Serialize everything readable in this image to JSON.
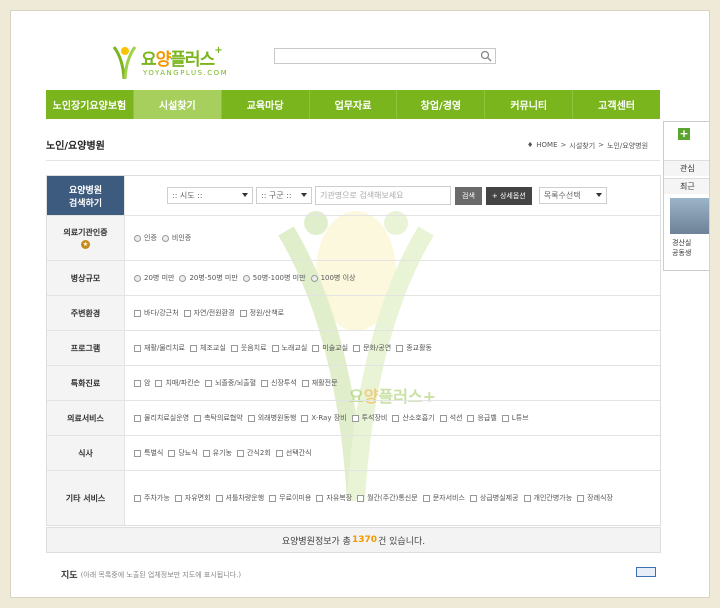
{
  "header": {
    "logo_text_a": "요",
    "logo_text_b": "양",
    "logo_text_c": "플러스",
    "logo_plus": "+",
    "logo_sub": "YOYANGPLUS.COM",
    "search_placeholder": "",
    "accent_color": "#7ab51d",
    "logo_orange": "#f39800"
  },
  "nav": {
    "items": [
      {
        "label": "노인장기요양보험",
        "active": false
      },
      {
        "label": "시설찾기",
        "active": true
      },
      {
        "label": "교육마당",
        "active": false
      },
      {
        "label": "업무자료",
        "active": false
      },
      {
        "label": "창업/경영",
        "active": false
      },
      {
        "label": "커뮤니티",
        "active": false
      },
      {
        "label": "고객센터",
        "active": false
      }
    ]
  },
  "side": {
    "tab1": "관심",
    "tab2": "최근",
    "caption1": "경산실",
    "caption2": "공동생"
  },
  "page": {
    "title": "노인/요양병원",
    "breadcrumb": [
      "HOME",
      ">",
      "시설찾기",
      ">",
      "노인/요양병원"
    ]
  },
  "form": {
    "header_label_1": "요양병원",
    "header_label_2": "검색하기",
    "sido": ":: 시도 ::",
    "gugun": ":: 구군 ::",
    "keyword_placeholder": "기관명으로 검색해보세요",
    "search_button": "검색",
    "detail_button": "+ 상세옵션",
    "rows_select": "목록수선택",
    "rows": [
      {
        "label": "의료기관인증",
        "type": "radio",
        "options": [
          "인증",
          "비인증"
        ]
      },
      {
        "label": "병상규모",
        "type": "radio",
        "options": [
          "20병 미만",
          "20병-50병 미만",
          "50병-100병 미만",
          "100병 이상"
        ]
      },
      {
        "label": "주변환경",
        "type": "check",
        "options": [
          "바다/강근처",
          "자연/전원환경",
          "정원/산책로"
        ]
      },
      {
        "label": "프로그램",
        "type": "check",
        "options": [
          "재활/물리치료",
          "체조교실",
          "웃음치료",
          "노래교실",
          "미술교실",
          "문화/공연",
          "종교활동"
        ]
      },
      {
        "label": "특화진료",
        "type": "check",
        "options": [
          "암",
          "치매/파킨슨",
          "뇌졸중/뇌출혈",
          "신장투석",
          "재활전문"
        ]
      },
      {
        "label": "의료서비스",
        "type": "check",
        "options": [
          "물리치료실운영",
          "촉탁의료협약",
          "외래병원동행",
          "X-Ray 장비",
          "투석장비",
          "산소호흡기",
          "석션",
          "응급벨",
          "L튜브"
        ]
      },
      {
        "label": "식사",
        "type": "check",
        "options": [
          "특별식",
          "당뇨식",
          "유기농",
          "간식2회",
          "선택간식"
        ]
      },
      {
        "label": "기타 서비스",
        "type": "check",
        "options": [
          "주차가능",
          "자유면회",
          "셔틀차량운행",
          "무료이미용",
          "자유복장",
          "월간(주간)통신문",
          "문자서비스",
          "상급병실제공",
          "개인간병가능",
          "장례식장"
        ]
      }
    ]
  },
  "result": {
    "prefix": "요양병원정보가 총 ",
    "count": "1370",
    "suffix": "건 있습니다."
  },
  "map": {
    "title": "지도",
    "note": "(아래 목록중에 노출된 업체정보만 지도에 표시됩니다.)"
  }
}
